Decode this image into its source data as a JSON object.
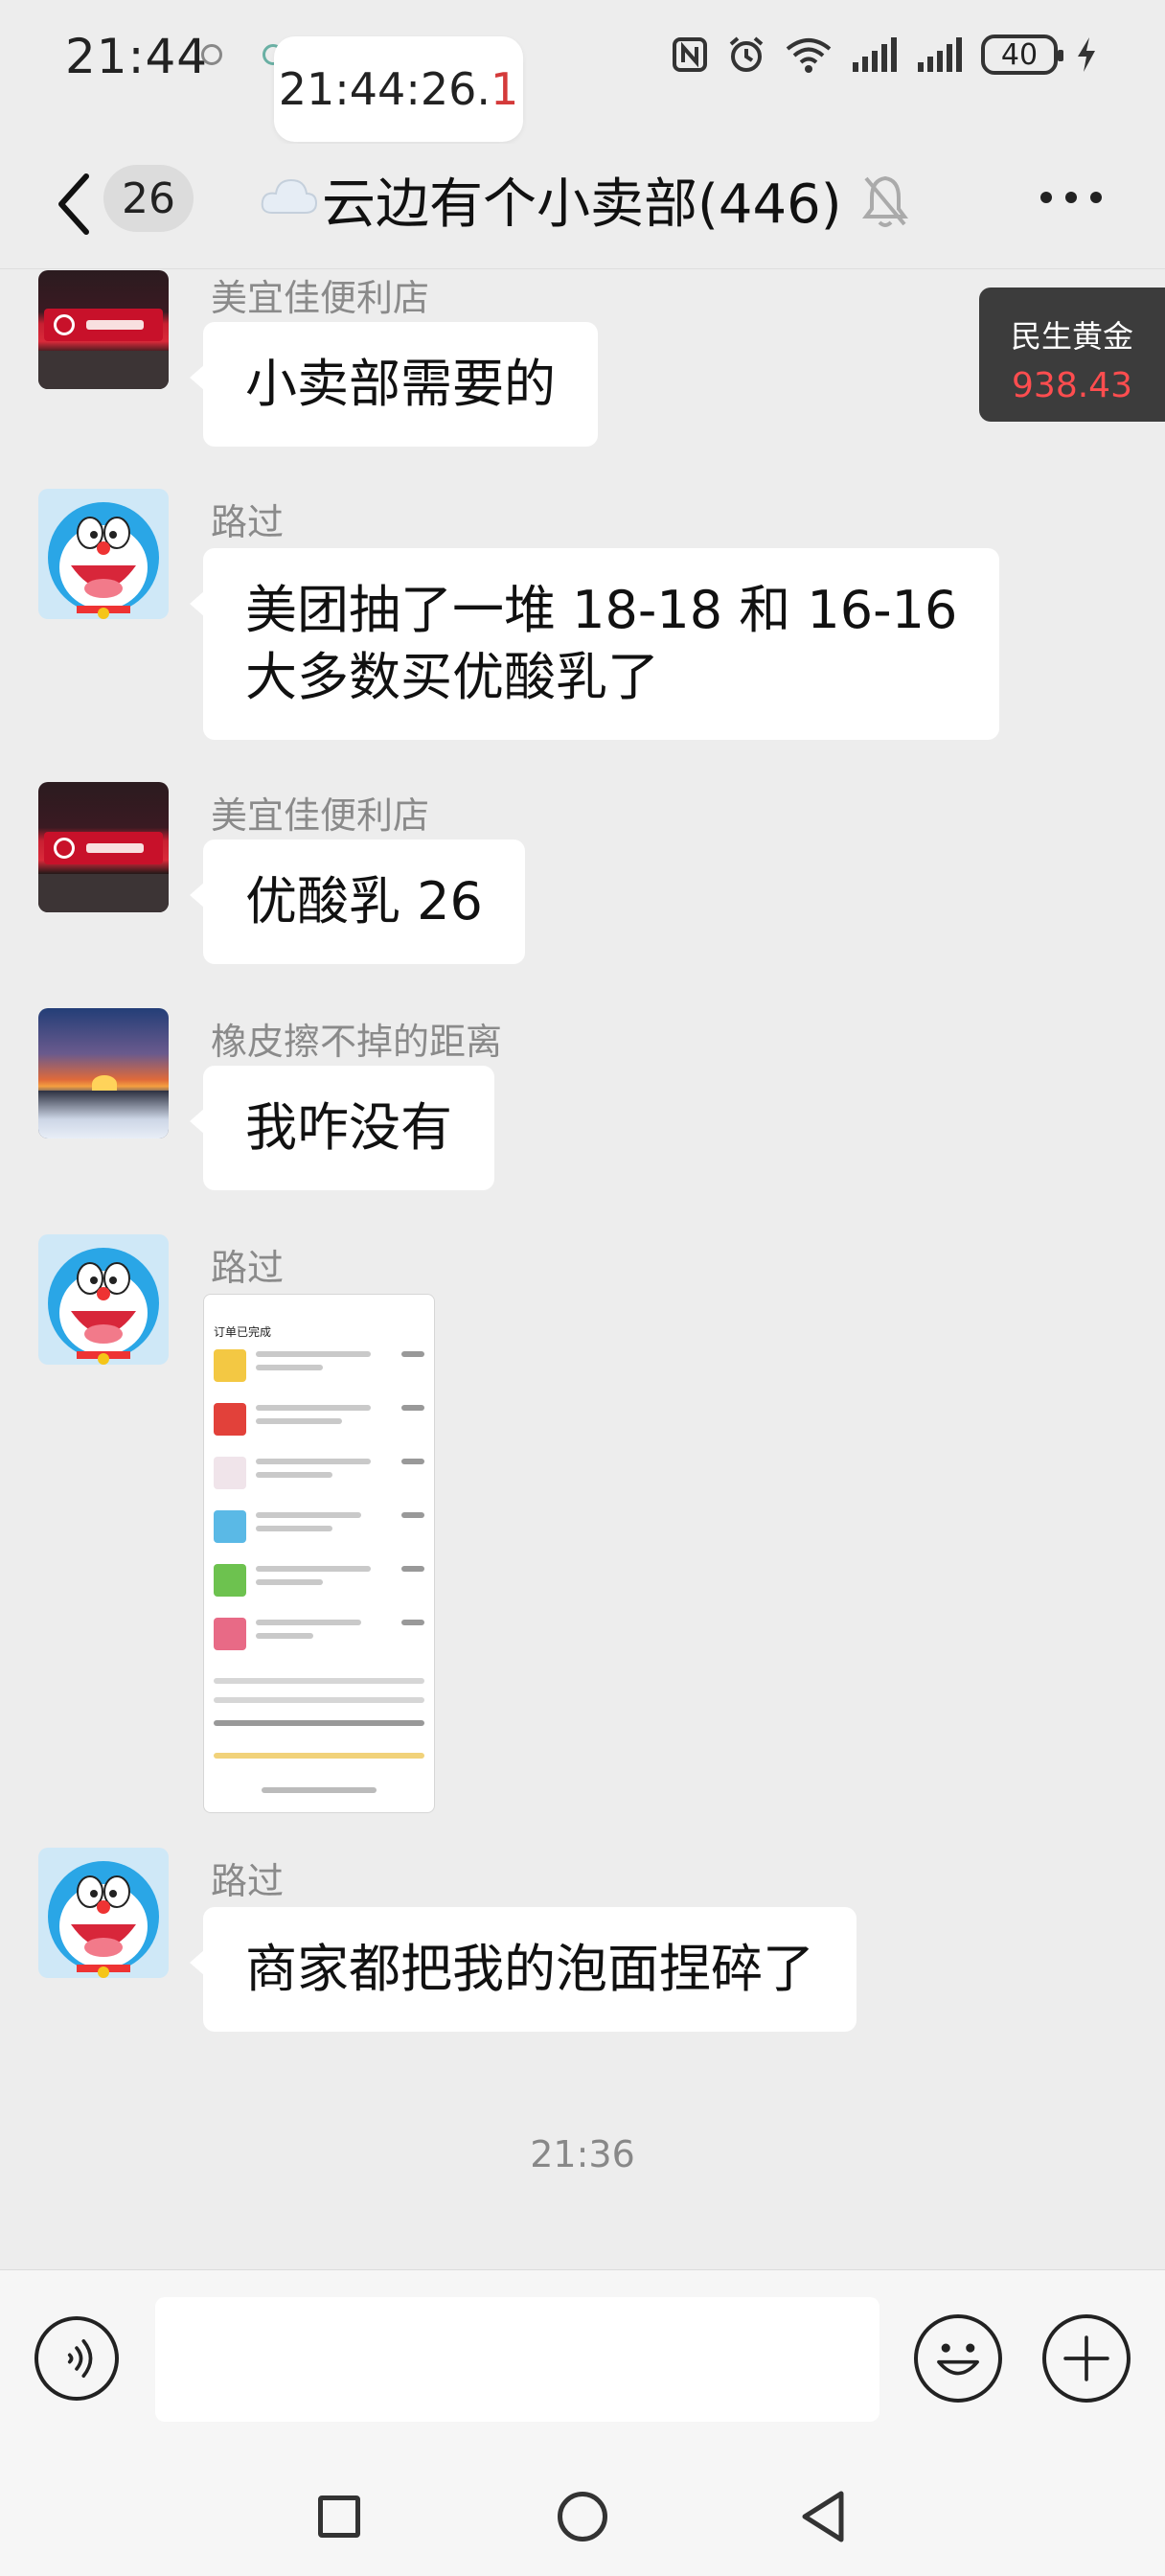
{
  "status_bar": {
    "time": "21:44",
    "floating_clock_main": "21:44:26.",
    "floating_clock_fraction": "1",
    "battery": "40"
  },
  "nav": {
    "unread_count": "26",
    "chat_title": "云边有个小卖部(446)"
  },
  "gold_widget": {
    "label": "民生黄金",
    "value": "938.43"
  },
  "messages": [
    {
      "sender": "美宜佳便利店",
      "text": "小卖部需要的"
    },
    {
      "sender": "路过",
      "lines": [
        "美团抽了一堆 18-18 和 16-16",
        "大多数买优酸乳了"
      ]
    },
    {
      "sender": "美宜佳便利店",
      "text": "优酸乳 26"
    },
    {
      "sender": "橡皮擦不掉的距离",
      "text": "我咋没有"
    },
    {
      "sender": "路过",
      "image": "order-screenshot",
      "image_title": "订单已完成"
    },
    {
      "sender": "路过",
      "text": "商家都把我的泡面捏碎了"
    }
  ],
  "time_separator": "21:36",
  "input": {
    "value": ""
  },
  "colors": {
    "background": "#ededed",
    "bubble": "#ffffff",
    "widget": "#3c3c3c",
    "widget_value": "#ff4d4f"
  },
  "icons": [
    "back-icon",
    "cloud-icon",
    "mute-bell-icon",
    "more-icon",
    "voice-icon",
    "emoji-icon",
    "plus-icon",
    "nav-recent-icon",
    "nav-home-icon",
    "nav-back-icon"
  ]
}
